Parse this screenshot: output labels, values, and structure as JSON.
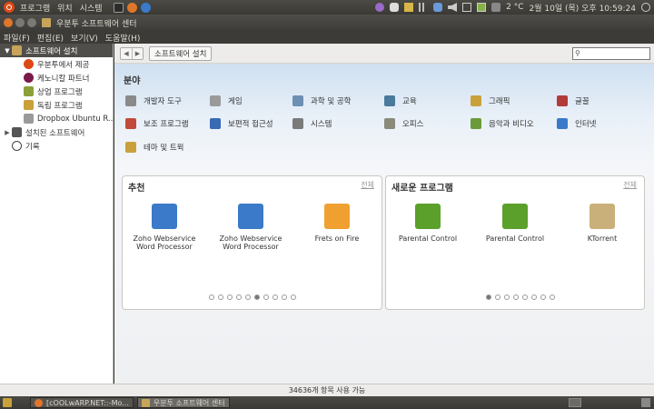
{
  "top_panel": {
    "menus": [
      "프로그램",
      "위치",
      "시스템"
    ],
    "weather": "2 °C",
    "clock": "2월 10일 (목) 오후 10:59:24"
  },
  "window": {
    "title": "우분투 소프트웨어 센터"
  },
  "menubar": [
    "파일(F)",
    "편집(E)",
    "보기(V)",
    "도움말(H)"
  ],
  "sidebar": {
    "items": [
      {
        "label": "소프트웨어 설치",
        "level": 0,
        "expander": "▼",
        "selected": true
      },
      {
        "label": "우분투에서 제공",
        "level": 1
      },
      {
        "label": "케노니칼 파트너",
        "level": 1
      },
      {
        "label": "상업 프로그램",
        "level": 1
      },
      {
        "label": "독립 프로그램",
        "level": 1
      },
      {
        "label": "Dropbox Ubuntu R...",
        "level": 1
      },
      {
        "label": "설치된 소프트웨어",
        "level": 0,
        "expander": "▶"
      },
      {
        "label": "기록",
        "level": 0
      }
    ]
  },
  "toolbar": {
    "breadcrumb": "소프트웨어 설치",
    "search_value": ""
  },
  "departments": {
    "title": "분야",
    "items": [
      {
        "label": "개발자 도구",
        "icon": "developer-tools-icon",
        "color": "#8a8a8a"
      },
      {
        "label": "게임",
        "icon": "games-icon",
        "color": "#9a9a9a"
      },
      {
        "label": "과학 및 공학",
        "icon": "science-icon",
        "color": "#6d8fb3"
      },
      {
        "label": "교육",
        "icon": "education-icon",
        "color": "#4a7a9c"
      },
      {
        "label": "그래픽",
        "icon": "graphics-icon",
        "color": "#c9a03a"
      },
      {
        "label": "글꼴",
        "icon": "fonts-icon",
        "color": "#b33a3a"
      },
      {
        "label": "보조 프로그램",
        "icon": "accessories-icon",
        "color": "#c24a3a"
      },
      {
        "label": "보편적 접근성",
        "icon": "accessibility-icon",
        "color": "#3a6ab3"
      },
      {
        "label": "시스템",
        "icon": "system-icon",
        "color": "#7a7a7a"
      },
      {
        "label": "오피스",
        "icon": "office-icon",
        "color": "#8a8a7a"
      },
      {
        "label": "음악과 비디오",
        "icon": "multimedia-icon",
        "color": "#6a9a3a"
      },
      {
        "label": "인터넷",
        "icon": "internet-icon",
        "color": "#3a7ac9"
      },
      {
        "label": "테마 및 트윅",
        "icon": "themes-icon",
        "color": "#c9a03a"
      }
    ]
  },
  "featured": {
    "title": "추천",
    "more": "전체",
    "apps": [
      {
        "name": "Zoho Webservice Word Processor",
        "icon": "document-edit-icon",
        "color": "#3a7ac9"
      },
      {
        "name": "Zoho Webservice Word Processor",
        "icon": "document-edit-icon",
        "color": "#3a7ac9"
      },
      {
        "name": "Frets on Fire",
        "icon": "flame-icon",
        "color": "#f0a030"
      }
    ],
    "pages": 10,
    "active_page": 6
  },
  "whats_new": {
    "title": "새로운 프로그램",
    "more": "전체",
    "apps": [
      {
        "name": "Parental Control",
        "icon": "stroller-icon",
        "color": "#5aa02a"
      },
      {
        "name": "Parental Control",
        "icon": "stroller-icon",
        "color": "#5aa02a"
      },
      {
        "name": "KTorrent",
        "icon": "ktorrent-icon",
        "color": "#c9b07a"
      }
    ],
    "pages": 8,
    "active_page": 1
  },
  "status": "34636개 항목 사용 가능",
  "taskbar": [
    {
      "label": "[cOOLwARP.NET::-Mo...",
      "active": false
    },
    {
      "label": "우분투 소프트웨어 센터",
      "active": true
    }
  ]
}
